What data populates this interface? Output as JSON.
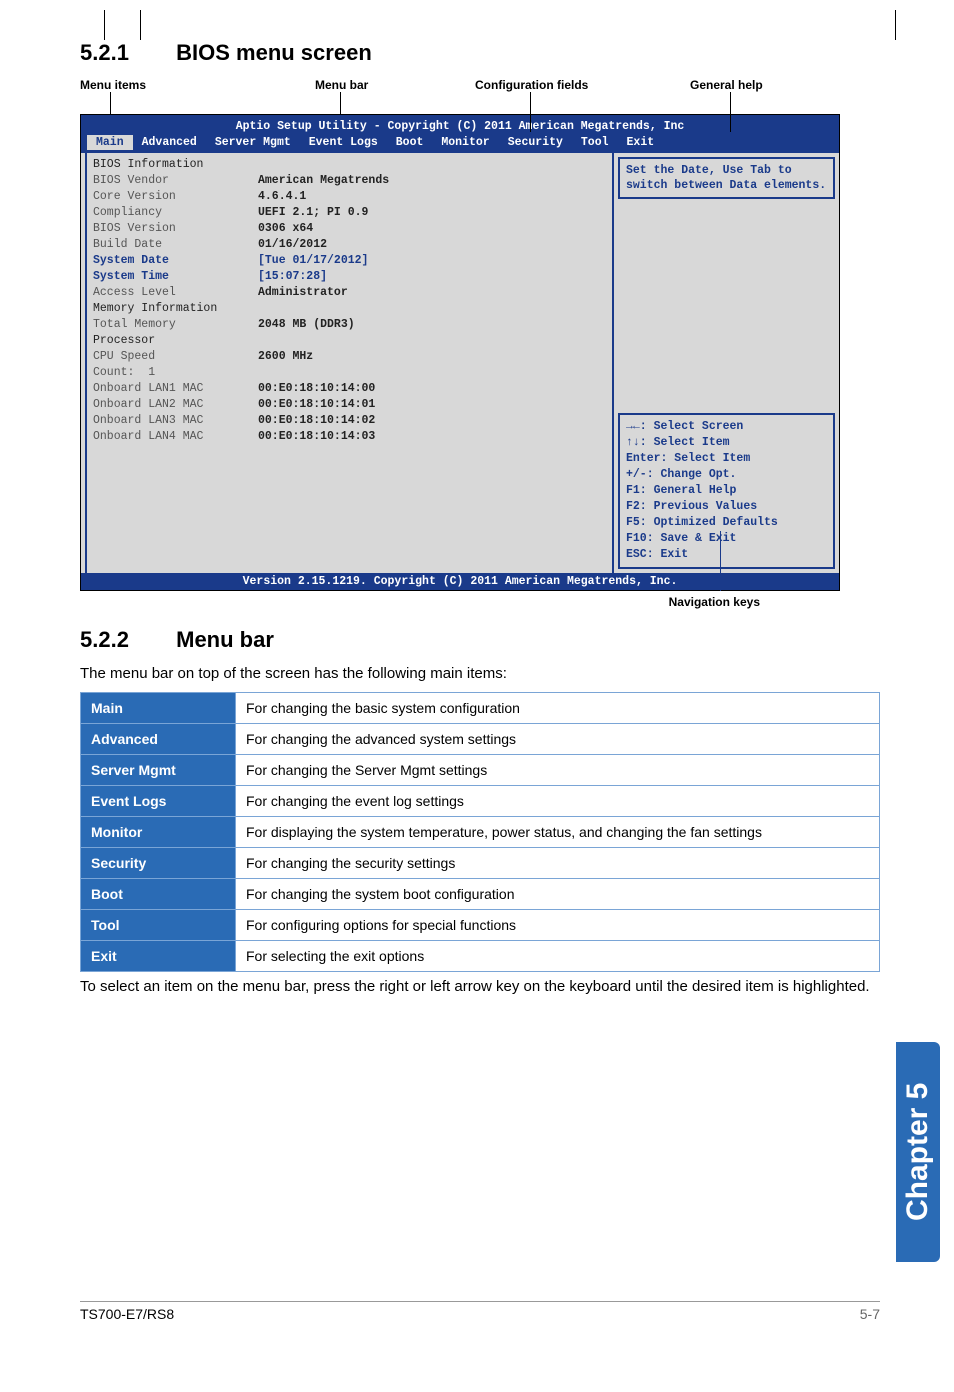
{
  "section1": {
    "num": "5.2.1",
    "title": "BIOS menu screen"
  },
  "diagram_labels": {
    "menu_items": "Menu items",
    "menu_bar": "Menu bar",
    "config_fields": "Configuration fields",
    "general_help": "General help",
    "nav_keys": "Navigation keys"
  },
  "bios": {
    "header_top": "Aptio Setup Utility - Copyright (C) 2011 American Megatrends, Inc",
    "tabs": [
      "Main",
      "Advanced",
      "Server Mgmt",
      "Event Logs",
      "Boot",
      "Monitor",
      "Security",
      "Tool",
      "Exit"
    ],
    "left_rows": [
      {
        "k": "BIOS Information",
        "v": "",
        "cls": "dark"
      },
      {
        "k": "BIOS Vendor",
        "v": "American Megatrends"
      },
      {
        "k": "Core Version",
        "v": "4.6.4.1"
      },
      {
        "k": "Compliancy",
        "v": "UEFI 2.1; PI 0.9"
      },
      {
        "k": "BIOS Version",
        "v": "0306 x64"
      },
      {
        "k": "Build Date",
        "v": "01/16/2012"
      },
      {
        "k": "",
        "v": ""
      },
      {
        "k": "",
        "v": ""
      },
      {
        "k": "System Date",
        "v": "[Tue 01/17/2012]",
        "blue": true
      },
      {
        "k": "System Time",
        "v": "[15:07:28]",
        "blue": true
      },
      {
        "k": "",
        "v": ""
      },
      {
        "k": "",
        "v": ""
      },
      {
        "k": "Access Level",
        "v": "Administrator"
      },
      {
        "k": "",
        "v": ""
      },
      {
        "k": "Memory Information",
        "v": "",
        "cls": "dark"
      },
      {
        "k": "Total Memory",
        "v": "2048 MB (DDR3)"
      },
      {
        "k": "",
        "v": ""
      },
      {
        "k": "Processor",
        "v": "",
        "cls": "dark"
      },
      {
        "k": "CPU Speed",
        "v": "2600 MHz"
      },
      {
        "k": "Count:  1",
        "v": ""
      },
      {
        "k": "",
        "v": ""
      },
      {
        "k": "Onboard LAN1 MAC",
        "v": "00:E0:18:10:14:00"
      },
      {
        "k": "Onboard LAN2 MAC",
        "v": "00:E0:18:10:14:01"
      },
      {
        "k": "Onboard LAN3 MAC",
        "v": "00:E0:18:10:14:02"
      },
      {
        "k": "Onboard LAN4 MAC",
        "v": "00:E0:18:10:14:03"
      }
    ],
    "help_text": "Set the Date, Use Tab to switch between Data elements.",
    "nav_lines": [
      "→←: Select Screen",
      "↑↓: Select Item",
      "Enter: Select Item",
      "+/-: Change Opt.",
      "F1: General Help",
      "F2: Previous Values",
      "F5: Optimized Defaults",
      "F10: Save & Exit",
      "ESC: Exit"
    ],
    "footer": "Version 2.15.1219. Copyright (C) 2011 American Megatrends, Inc."
  },
  "section2": {
    "num": "5.2.2",
    "title": "Menu bar"
  },
  "section2_desc": "The menu bar on top of the screen has the following main items:",
  "menu_table": [
    {
      "h": "Main",
      "d": "For changing the basic system configuration"
    },
    {
      "h": "Advanced",
      "d": "For changing the advanced system settings"
    },
    {
      "h": "Server Mgmt",
      "d": "For changing the Server Mgmt settings"
    },
    {
      "h": "Event Logs",
      "d": "For changing the event log settings"
    },
    {
      "h": "Monitor",
      "d": "For displaying the system temperature, power status, and changing the fan settings"
    },
    {
      "h": "Security",
      "d": "For changing the security settings"
    },
    {
      "h": "Boot",
      "d": "For changing the system boot configuration"
    },
    {
      "h": "Tool",
      "d": "For configuring options for special functions"
    },
    {
      "h": "Exit",
      "d": "For selecting the exit options"
    }
  ],
  "after_table": "To select an item on the menu bar, press the right or left arrow key on the keyboard until the desired item is highlighted.",
  "side_tab": "Chapter 5",
  "footer": {
    "model": "TS700-E7/RS8",
    "page": "5-7"
  }
}
